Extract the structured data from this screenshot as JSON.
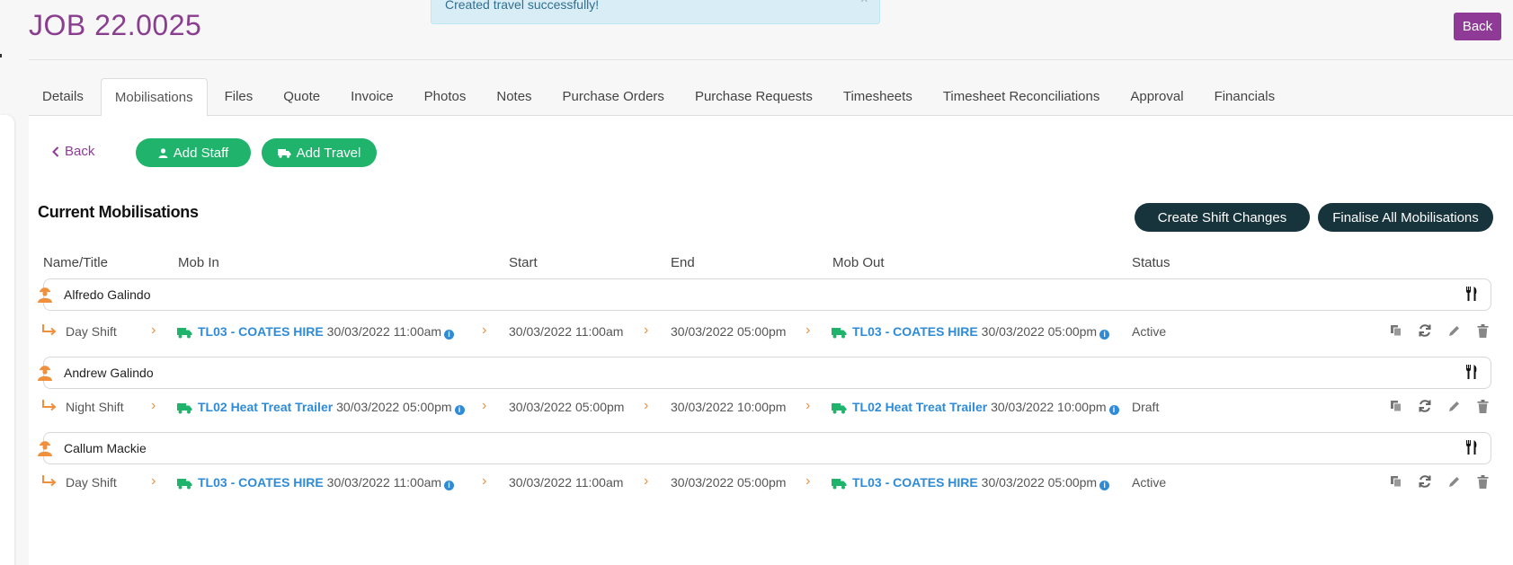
{
  "page": {
    "title": "JOB 22.0025",
    "back_label": "Back"
  },
  "toast": {
    "message": "Created travel successfully!",
    "close": "×"
  },
  "tabs": [
    {
      "label": "Details"
    },
    {
      "label": "Mobilisations",
      "active": true
    },
    {
      "label": "Files"
    },
    {
      "label": "Quote"
    },
    {
      "label": "Invoice"
    },
    {
      "label": "Photos"
    },
    {
      "label": "Notes"
    },
    {
      "label": "Purchase Orders"
    },
    {
      "label": "Purchase Requests"
    },
    {
      "label": "Timesheets"
    },
    {
      "label": "Timesheet Reconciliations"
    },
    {
      "label": "Approval"
    },
    {
      "label": "Financials"
    }
  ],
  "toolbar": {
    "back_label": "Back",
    "add_staff": "Add Staff",
    "add_travel": "Add Travel"
  },
  "section": {
    "title": "Current Mobilisations",
    "create_shift_changes": "Create Shift Changes",
    "finalise_all": "Finalise All Mobilisations"
  },
  "columns": {
    "name": "Name/Title",
    "mob_in": "Mob In",
    "start": "Start",
    "end": "End",
    "mob_out": "Mob Out",
    "status": "Status"
  },
  "mobilisations": [
    {
      "name": "Alfredo Galindo",
      "shift": "Day Shift",
      "mob_in_vehicle": "TL03 - COATES HIRE",
      "mob_in_time": "30/03/2022 11:00am",
      "start": "30/03/2022 11:00am",
      "end": "30/03/2022 05:00pm",
      "mob_out_vehicle": "TL03 - COATES HIRE",
      "mob_out_time": "30/03/2022 05:00pm",
      "status": "Active"
    },
    {
      "name": "Andrew Galindo",
      "shift": "Night Shift",
      "mob_in_vehicle": "TL02 Heat Treat Trailer",
      "mob_in_time": "30/03/2022 05:00pm",
      "start": "30/03/2022 05:00pm",
      "end": "30/03/2022 10:00pm",
      "mob_out_vehicle": "TL02 Heat Treat Trailer",
      "mob_out_time": "30/03/2022 10:00pm",
      "status": "Draft"
    },
    {
      "name": "Callum Mackie",
      "shift": "Day Shift",
      "mob_in_vehicle": "TL03 - COATES HIRE",
      "mob_in_time": "30/03/2022 11:00am",
      "start": "30/03/2022 11:00am",
      "end": "30/03/2022 05:00pm",
      "mob_out_vehicle": "TL03 - COATES HIRE",
      "mob_out_time": "30/03/2022 05:00pm",
      "status": "Active"
    }
  ],
  "colors": {
    "brand_purple": "#8e3a96",
    "green": "#1fb36b",
    "dark": "#17343d",
    "link_blue": "#2e8bd8",
    "orange": "#f0903c"
  },
  "icons": {
    "person": "worker-icon",
    "cutlery": "cutlery-icon",
    "shift": "shift-arrow-icon",
    "truck": "truck-icon",
    "info": "info-icon",
    "copy": "copy-icon",
    "refresh": "refresh-icon",
    "edit": "pencil-icon",
    "delete": "trash-icon"
  }
}
